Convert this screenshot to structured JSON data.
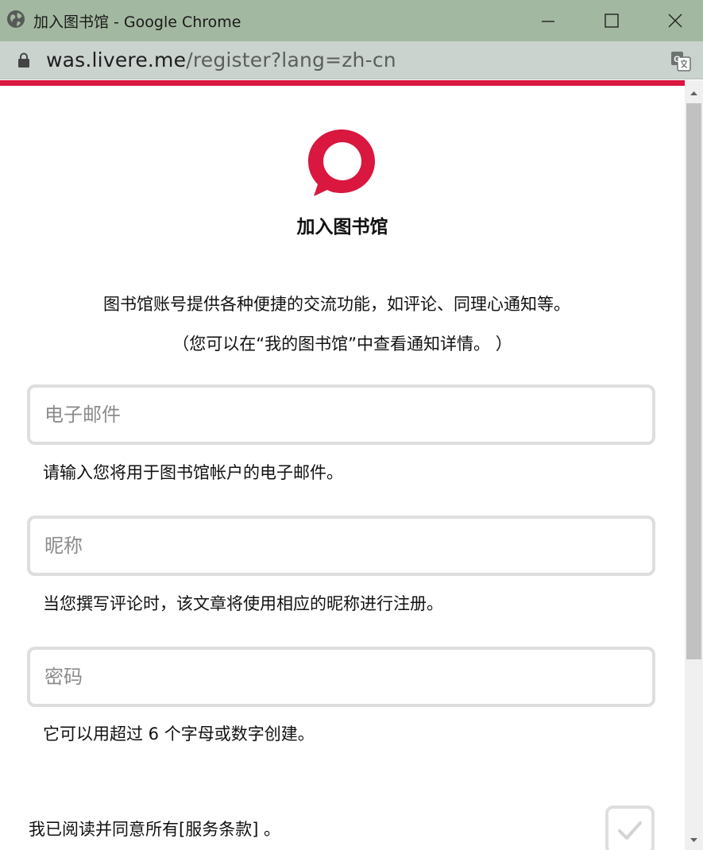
{
  "window": {
    "title": "加入图书馆 - Google Chrome",
    "minimize_icon": "minimize-icon",
    "maximize_icon": "maximize-icon",
    "close_icon": "close-icon"
  },
  "addressbar": {
    "url_host": "was.livere.me",
    "url_path": "/register?lang=zh-cn",
    "lock_icon": "lock-icon",
    "translate_icon": "translate-icon"
  },
  "brand": {
    "accent": "#d9173f",
    "logo": "livere-speech-bubble-logo"
  },
  "page": {
    "title": "加入图书馆",
    "description_line1": "图书馆账号提供各种便捷的交流功能，如评论、同理心通知等。",
    "description_line2": "（您可以在“我的图书馆”中查看通知详情。 ）"
  },
  "form": {
    "email": {
      "placeholder": "电子邮件",
      "value": "",
      "hint": "请输入您将用于图书馆帐户的电子邮件。"
    },
    "nickname": {
      "placeholder": "昵称",
      "value": "",
      "hint": "当您撰写评论时，该文章将使用相应的昵称进行注册。"
    },
    "password": {
      "placeholder": "密码",
      "value": "",
      "hint": "它可以用超过 6 个字母或数字创建。"
    },
    "agree": {
      "label": "我已阅读并同意所有[服务条款] 。",
      "checked": false
    }
  }
}
